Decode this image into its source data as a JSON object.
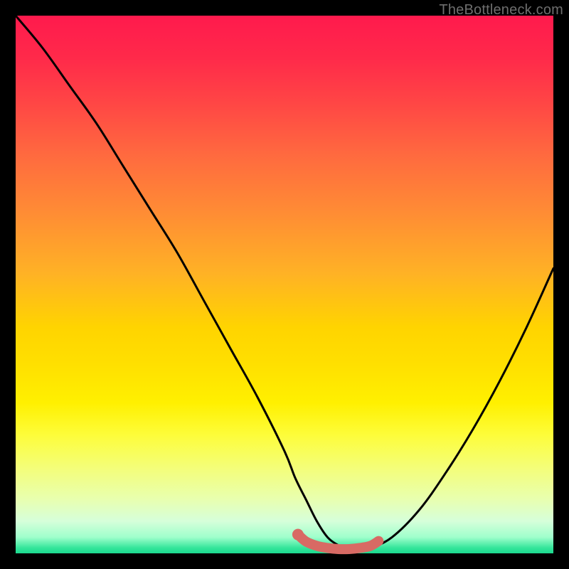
{
  "watermark": "TheBottleneck.com",
  "chart_data": {
    "type": "line",
    "title": "",
    "xlabel": "",
    "ylabel": "",
    "xlim": [
      0,
      100
    ],
    "ylim": [
      0,
      100
    ],
    "series": [
      {
        "name": "bottleneck-curve",
        "x": [
          0,
          5,
          10,
          15,
          20,
          25,
          30,
          35,
          40,
          45,
          50,
          52,
          54,
          56,
          58,
          60,
          62,
          64,
          66,
          70,
          75,
          80,
          85,
          90,
          95,
          100
        ],
        "y": [
          100,
          94,
          87,
          80,
          72,
          64,
          56,
          47,
          38,
          29,
          19,
          14,
          10,
          6,
          3,
          1.5,
          0.5,
          0.5,
          1,
          3,
          8,
          15,
          23,
          32,
          42,
          53
        ]
      },
      {
        "name": "optimal-zone-highlight",
        "x": [
          52.5,
          54,
          56,
          58,
          60,
          62,
          64,
          66,
          67.5
        ],
        "y": [
          3.5,
          2.2,
          1.4,
          1.0,
          0.8,
          0.8,
          1.0,
          1.4,
          2.3
        ]
      }
    ],
    "colors": {
      "curve": "#000000",
      "highlight": "#d86a64",
      "highlight_dot": "#d86a64"
    }
  }
}
